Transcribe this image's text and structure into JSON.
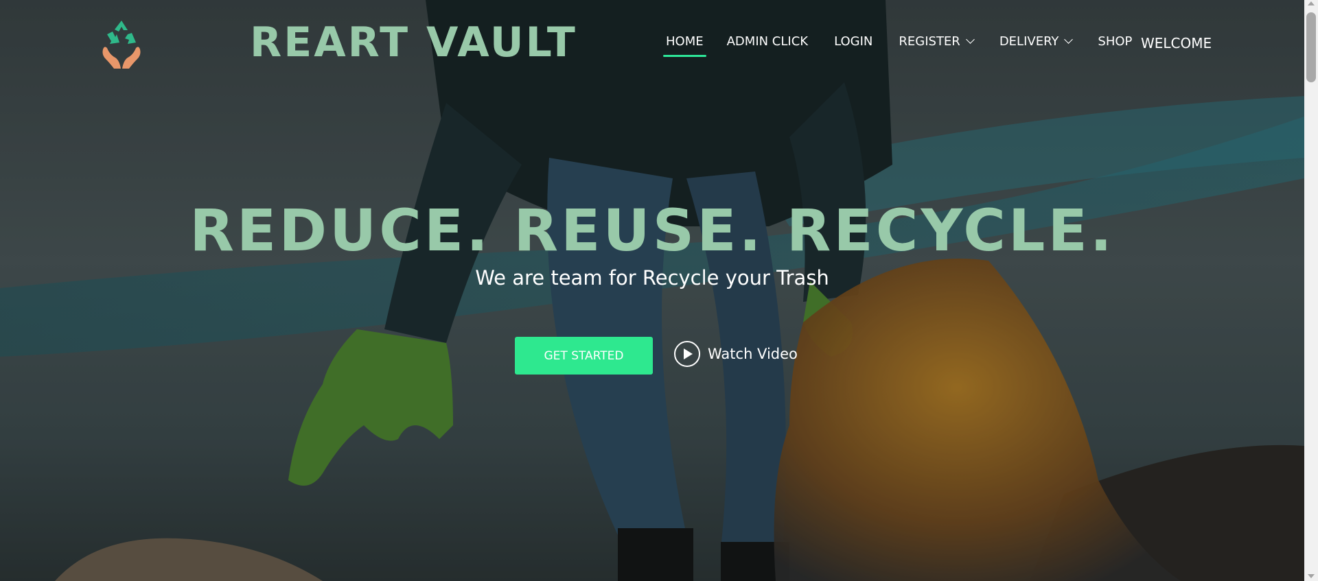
{
  "brand": {
    "name": "REART VAULT",
    "logo_icon": "recycle-hands-icon"
  },
  "nav": {
    "items": [
      {
        "label": "HOME",
        "active": true,
        "dropdown": false
      },
      {
        "label": "ADMIN CLICK",
        "active": false,
        "dropdown": false
      },
      {
        "label": "LOGIN",
        "active": false,
        "dropdown": false
      },
      {
        "label": "REGISTER",
        "active": false,
        "dropdown": true
      },
      {
        "label": "DELIVERY",
        "active": false,
        "dropdown": true
      },
      {
        "label": "SHOP",
        "active": false,
        "dropdown": false
      }
    ],
    "welcome": "WELCOME"
  },
  "hero": {
    "title": "REDUCE. REUSE. RECYCLE.",
    "subtitle": "We are team for Recycle your Trash",
    "cta_label": "GET STARTED",
    "video_label": "Watch Video"
  },
  "colors": {
    "accent": "#2ee88f",
    "brand_text": "#98c9a9",
    "active_underline": "#2ee89a"
  }
}
